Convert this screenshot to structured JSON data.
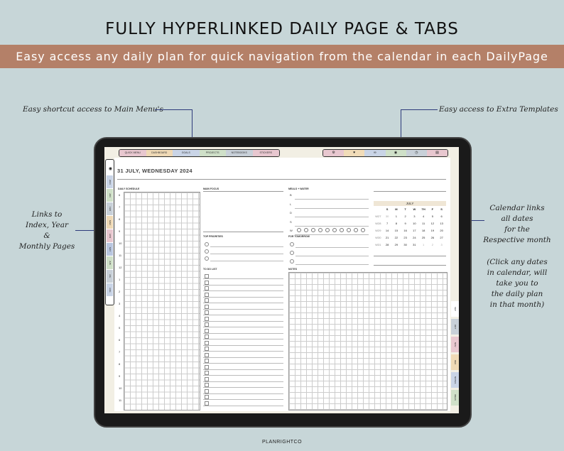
{
  "title": "FULLY HYPERLINKED DAILY PAGE & TABS",
  "banner": "Easy access any daily plan for quick navigation from the calendar in each DailyPage",
  "callouts": {
    "main_menu": "Easy shortcut access to Main Menu's",
    "extra_templates": "Easy access to Extra Templates",
    "links_index": [
      "Links to",
      "Index, Year",
      "&",
      "Monthly Pages"
    ],
    "calendar_links": [
      "Calendar links",
      "all dates",
      "for the",
      "Respective month"
    ],
    "click_dates": [
      "(Click any dates",
      "in calendar, will",
      "take you to",
      "the daily plan",
      "in that month)"
    ]
  },
  "nav_tabs": [
    {
      "label": "QUICK MENU",
      "color": "#e8c7cf"
    },
    {
      "label": "DASHBOARD",
      "color": "#efd9b5"
    },
    {
      "label": "GOALS",
      "color": "#c9d4e6"
    },
    {
      "label": "PROJECTS",
      "color": "#cfe0c8"
    },
    {
      "label": "NOTEBOOKS",
      "color": "#c8d0d8"
    },
    {
      "label": "STICKERS",
      "color": "#e8c7cf"
    }
  ],
  "icon_tabs": [
    {
      "icon": "gear-icon",
      "glyph": "⚙",
      "color": "#e8c7cf"
    },
    {
      "icon": "heart-icon",
      "glyph": "♥",
      "color": "#f1dcb8"
    },
    {
      "icon": "link-icon",
      "glyph": "∞",
      "color": "#c9d4e6"
    },
    {
      "icon": "globe-icon",
      "glyph": "◉",
      "color": "#cfe0c8"
    },
    {
      "icon": "clock-icon",
      "glyph": "◷",
      "color": "#c8d0d8"
    },
    {
      "icon": "book-icon",
      "glyph": "▤",
      "color": "#e8c7cf"
    }
  ],
  "left_tabs": [
    {
      "label": "",
      "color": "#ffffff"
    },
    {
      "label": "2024",
      "color": "#c9d4e6"
    },
    {
      "label": "JAN",
      "color": "#cfe0c8"
    },
    {
      "label": "FEB",
      "color": "#c8d0d8"
    },
    {
      "label": "MAR",
      "color": "#efd9b5"
    },
    {
      "label": "APR",
      "color": "#e8c7cf"
    },
    {
      "label": "MAY",
      "color": "#b9c6df"
    },
    {
      "label": "JUN",
      "color": "#cfe0c8"
    },
    {
      "label": "JUL",
      "color": "#c8d0d8"
    },
    {
      "label": "AUG",
      "color": "#c9d4e6"
    }
  ],
  "right_tabs": [
    {
      "label": "SEP",
      "color": "#ffffff"
    },
    {
      "label": "OCT",
      "color": "#c8d0d8"
    },
    {
      "label": "NOV",
      "color": "#e8c7cf"
    },
    {
      "label": "DEC",
      "color": "#efd9b5"
    },
    {
      "label": "NOTES",
      "color": "#c9d4e6"
    },
    {
      "label": "IDEAS",
      "color": "#cfe0c8"
    }
  ],
  "date": "31 JULY, WEDNESDAY 2024",
  "sections": {
    "schedule": "DAILY SCHEDULE",
    "focus": "MAIN FOCUS",
    "meals": "MEALS + WATER",
    "priorities": "TOP PRIORITIES",
    "tomorrow": "FOR TOMORROW",
    "todo": "TO DO LIST",
    "notes": "NOTES"
  },
  "hours": [
    "6",
    "7",
    "8",
    "9",
    "10",
    "11",
    "12",
    "1",
    "2",
    "3",
    "4",
    "5",
    "6",
    "7",
    "8",
    "9",
    "10",
    "11"
  ],
  "meals": [
    "B",
    "L",
    "D",
    "S",
    "W"
  ],
  "calendar": {
    "month": "JULY",
    "weekdays": [
      "S",
      "M",
      "T",
      "W",
      "TH",
      "F",
      "S"
    ],
    "weeks": [
      {
        "wk": "W27",
        "days": [
          "30",
          "1",
          "2",
          "3",
          "4",
          "5",
          "6"
        ]
      },
      {
        "wk": "W28",
        "days": [
          "7",
          "8",
          "9",
          "10",
          "11",
          "12",
          "13"
        ]
      },
      {
        "wk": "W29",
        "days": [
          "14",
          "15",
          "16",
          "17",
          "18",
          "19",
          "20"
        ]
      },
      {
        "wk": "W30",
        "days": [
          "21",
          "22",
          "23",
          "24",
          "25",
          "26",
          "27"
        ]
      },
      {
        "wk": "W31",
        "days": [
          "28",
          "29",
          "30",
          "31",
          "1",
          "2",
          "3"
        ]
      }
    ]
  },
  "footer": "PLANRIGHTCO"
}
